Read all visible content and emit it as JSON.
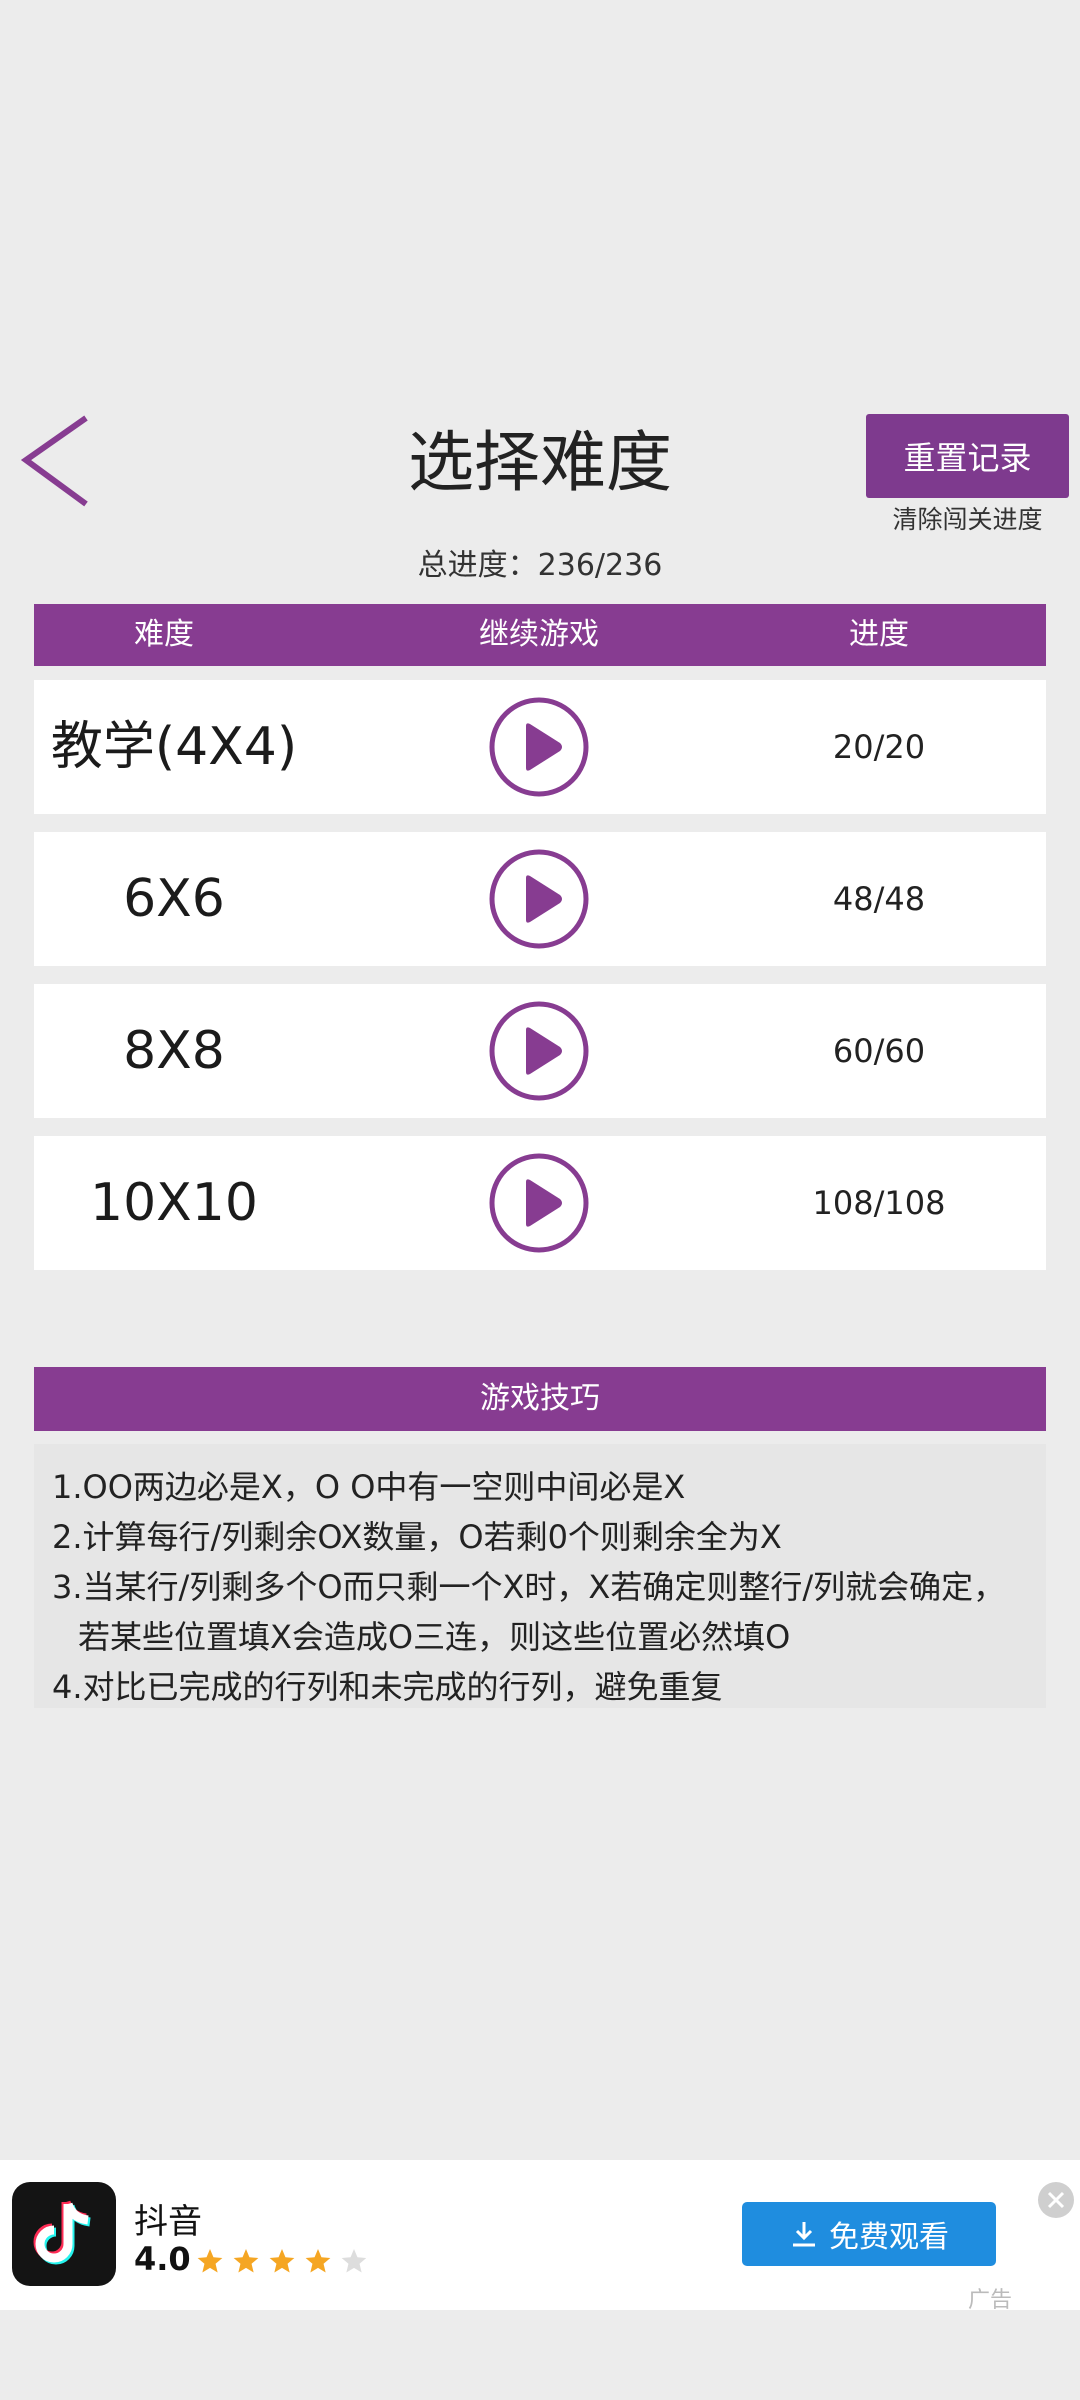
{
  "header": {
    "title": "选择难度",
    "reset_label": "重置记录",
    "reset_subtitle": "清除闯关进度",
    "total_progress": "总进度：236/236"
  },
  "table": {
    "columns": [
      "难度",
      "继续游戏",
      "进度"
    ],
    "rows": [
      {
        "name": "教学(4X4)",
        "progress": "20/20"
      },
      {
        "name": "6X6",
        "progress": "48/48"
      },
      {
        "name": "8X8",
        "progress": "60/60"
      },
      {
        "name": "10X10",
        "progress": "108/108"
      }
    ]
  },
  "tips": {
    "title": "游戏技巧",
    "lines": [
      "1.OO两边必是X，O O中有一空则中间必是X",
      "2.计算每行/列剩余OX数量，O若剩0个则剩余全为X",
      "3.当某行/列剩多个O而只剩一个X时，X若确定则整行/列就会确定，",
      "若某些位置填X会造成O三连，则这些位置必然填O",
      "4.对比已完成的行列和未完成的行列，避免重复"
    ]
  },
  "ad": {
    "app_name": "抖音",
    "rating": "4.0",
    "stars": 4,
    "stars_max": 5,
    "button_label": "免费观看",
    "ad_label": "广告"
  },
  "colors": {
    "accent": "#873c91",
    "ad_button": "#1f8ddf",
    "star": "#f5a623"
  },
  "icons": {
    "back": "chevron-left-icon",
    "play": "play-circle-icon",
    "download": "download-icon",
    "close": "close-icon",
    "star": "star-icon"
  }
}
